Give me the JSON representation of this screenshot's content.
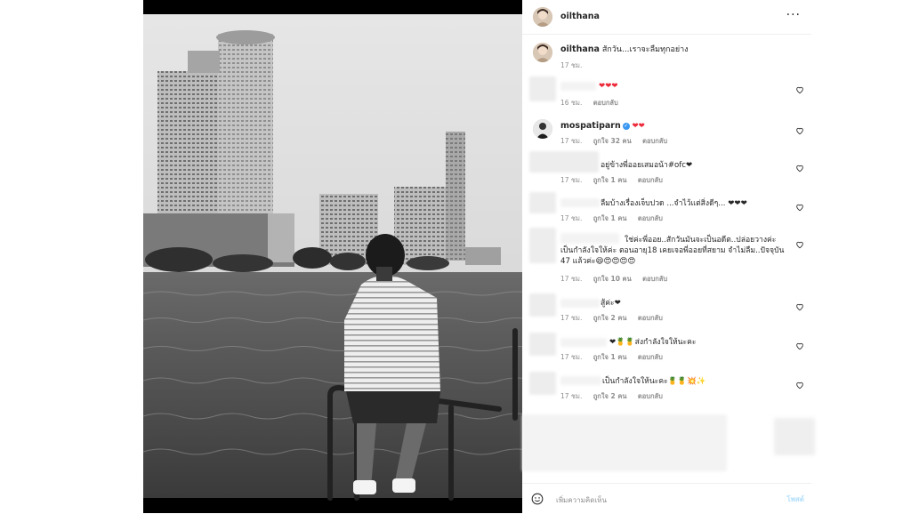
{
  "post": {
    "username": "oilthana",
    "more_icon": "more-horizontal-icon"
  },
  "caption": {
    "username": "oilthana",
    "text": "สักวัน...เราจะลืมทุกอย่าง",
    "time": "17 ชม."
  },
  "comments": [
    {
      "username": "",
      "text": "❤❤❤",
      "time": "16 ชม.",
      "likes": "",
      "reply": "ตอบกลับ"
    },
    {
      "username": "mospatiparn",
      "verified": true,
      "text": "❤❤",
      "time": "17 ชม.",
      "likes": "ถูกใจ 32 คน",
      "reply": "ตอบกลับ"
    },
    {
      "username": "",
      "text": "อยู่ข้างพี่ออยเสมอน้า#ofc❤",
      "time": "17 ชม.",
      "likes": "ถูกใจ 1 คน",
      "reply": "ตอบกลับ"
    },
    {
      "username": "",
      "text": "ลืมบ้างเรื่องเจ็บปวด ...จำไว้แต่สิ่งดีๆ... ❤❤❤",
      "time": "17 ชม.",
      "likes": "ถูกใจ 1 คน",
      "reply": "ตอบกลับ"
    },
    {
      "username": "",
      "text": "ใช่ค่ะพี่ออย..สักวันมันจะเป็นอดีต..ปล่อยวางค่ะ เป็นกำลังใจให้ค่ะ ตอนอายุ18 เคยเจอพี่ออยที่สยาม จำไม่ลืม..ปัจจุบัน 47 แล้วค่ะ😄😍😍😍😍",
      "time": "17 ชม.",
      "likes": "ถูกใจ 10 คน",
      "reply": "ตอบกลับ"
    },
    {
      "username": "",
      "text": "สู้ค่ะ❤",
      "time": "17 ชม.",
      "likes": "ถูกใจ 2 คน",
      "reply": "ตอบกลับ"
    },
    {
      "username": "",
      "text": "❤🍍🍍ส่งกำลังใจให้นะคะ",
      "time": "17 ชม.",
      "likes": "ถูกใจ 1 คน",
      "reply": "ตอบกลับ"
    },
    {
      "username": "",
      "text": "เป็นกำลังใจให้นะคะ🍍🍍💥✨",
      "time": "17 ชม.",
      "likes": "ถูกใจ 2 คน",
      "reply": "ตอบกลับ"
    }
  ],
  "footer": {
    "emoji_icon": "smiley-icon",
    "placeholder": "เพิ่มความคิดเห็น",
    "post_label": "โพสต์"
  },
  "colors": {
    "heart": "#ed2939",
    "verified": "#3897f0",
    "meta": "#8e8e8e",
    "post_button": "#b2dffc"
  }
}
